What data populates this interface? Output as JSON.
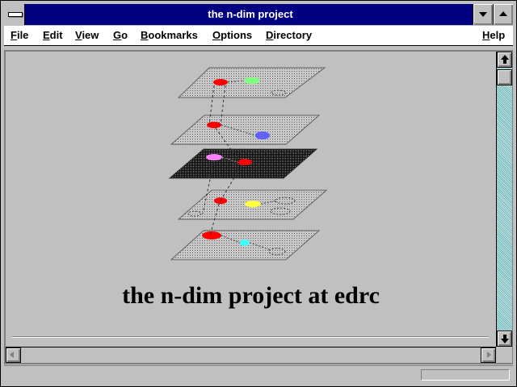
{
  "window": {
    "title": "the n-dim project"
  },
  "menu": {
    "items": [
      {
        "label": "File",
        "u": "F",
        "rest": "ile"
      },
      {
        "label": "Edit",
        "u": "E",
        "rest": "dit"
      },
      {
        "label": "View",
        "u": "V",
        "rest": "iew"
      },
      {
        "label": "Go",
        "u": "G",
        "rest": "o"
      },
      {
        "label": "Bookmarks",
        "u": "B",
        "rest": "ookmarks"
      },
      {
        "label": "Options",
        "u": "O",
        "rest": "ptions"
      },
      {
        "label": "Directory",
        "u": "D",
        "rest": "irectory"
      },
      {
        "label": "Help",
        "u": "H",
        "rest": "elp"
      }
    ]
  },
  "page": {
    "heading": "the n-dim project at edrc"
  },
  "status": {
    "text": ""
  },
  "colors": {
    "titlebar": "#000080",
    "plane_light": "#c8c8c8",
    "plane_dark": "#202020",
    "nodes": [
      "#ff0000",
      "#80ff80",
      "#6060ff",
      "#ff80ff",
      "#ffff40",
      "#40ffff"
    ]
  },
  "icons": [
    "system-menu-icon",
    "minimize-icon",
    "maximize-icon",
    "scroll-up-icon",
    "scroll-down-icon",
    "scroll-left-icon",
    "scroll-right-icon"
  ]
}
